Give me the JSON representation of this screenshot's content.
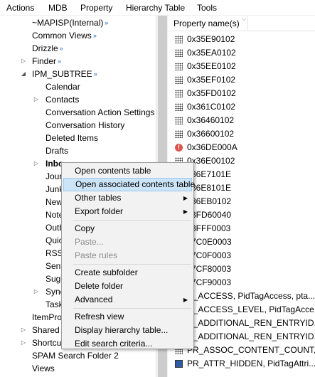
{
  "menubar": {
    "items": [
      "Actions",
      "MDB",
      "Property",
      "Hierarchy Table",
      "Tools"
    ]
  },
  "tree": {
    "rows": [
      {
        "label": "~MAPISP(Internal)",
        "arrows": "»",
        "expander": ""
      },
      {
        "label": "Common Views",
        "arrows": "»",
        "expander": ""
      },
      {
        "label": "Drizzle",
        "arrows": "»",
        "expander": ""
      },
      {
        "label": "Finder",
        "arrows": "»",
        "expander": "▷"
      },
      {
        "label": "IPM_SUBTREE",
        "arrows": "»",
        "expander": "◢"
      },
      {
        "label": "Calendar",
        "arrows": "",
        "expander": ""
      },
      {
        "label": "Contacts",
        "arrows": "",
        "expander": "▷"
      },
      {
        "label": "Conversation Action Settings",
        "arrows": "",
        "expander": ""
      },
      {
        "label": "Conversation History",
        "arrows": "",
        "expander": ""
      },
      {
        "label": "Deleted Items",
        "arrows": "",
        "expander": ""
      },
      {
        "label": "Drafts",
        "arrows": "",
        "expander": ""
      },
      {
        "label": "Inbo",
        "arrows": "",
        "expander": "▷"
      },
      {
        "label": "Jour",
        "arrows": "",
        "expander": ""
      },
      {
        "label": "Junk",
        "arrows": "",
        "expander": ""
      },
      {
        "label": "New",
        "arrows": "",
        "expander": ""
      },
      {
        "label": "Note",
        "arrows": "",
        "expander": ""
      },
      {
        "label": "Outb",
        "arrows": "",
        "expander": ""
      },
      {
        "label": "Quic",
        "arrows": "",
        "expander": ""
      },
      {
        "label": "RSS",
        "arrows": "",
        "expander": ""
      },
      {
        "label": "Sent",
        "arrows": "",
        "expander": ""
      },
      {
        "label": "Sugg",
        "arrows": "",
        "expander": ""
      },
      {
        "label": "Sync",
        "arrows": "",
        "expander": "▷"
      },
      {
        "label": "Task",
        "arrows": "",
        "expander": ""
      },
      {
        "label": "ItemPro",
        "arrows": "",
        "expander": ""
      },
      {
        "label": "Shared",
        "arrows": "",
        "expander": "▷"
      },
      {
        "label": "Shortcu",
        "arrows": "",
        "expander": "▷"
      },
      {
        "label": "SPAM Search Folder 2",
        "arrows": "",
        "expander": ""
      },
      {
        "label": "Views",
        "arrows": "",
        "expander": ""
      }
    ]
  },
  "properties": {
    "column_header": "Property name(s)",
    "rows": [
      {
        "name": "0x35E90102",
        "icon": "grid"
      },
      {
        "name": "0x35EA0102",
        "icon": "grid"
      },
      {
        "name": "0x35EE0102",
        "icon": "grid"
      },
      {
        "name": "0x35EF0102",
        "icon": "grid"
      },
      {
        "name": "0x35FD0102",
        "icon": "grid"
      },
      {
        "name": "0x361C0102",
        "icon": "grid"
      },
      {
        "name": "0x36460102",
        "icon": "grid"
      },
      {
        "name": "0x36600102",
        "icon": "grid"
      },
      {
        "name": "0x36DE000A",
        "icon": "error"
      },
      {
        "name": "0x36E00102",
        "icon": "grid"
      },
      {
        "name": "x36E7101E",
        "icon": "grid"
      },
      {
        "name": "x36E8101E",
        "icon": "grid"
      },
      {
        "name": "x36EB0102",
        "icon": "grid"
      },
      {
        "name": "x3FD60040",
        "icon": "grid"
      },
      {
        "name": "x3FFF0003",
        "icon": "grid"
      },
      {
        "name": "x7C0E0003",
        "icon": "grid"
      },
      {
        "name": "x7C0F0003",
        "icon": "grid"
      },
      {
        "name": "x7CF80003",
        "icon": "grid"
      },
      {
        "name": "x7CF90003",
        "icon": "grid"
      },
      {
        "name": "R_ACCESS, PidTagAccess, pta...",
        "icon": "grid"
      },
      {
        "name": "R_ACCESS_LEVEL, PidTagAcce...",
        "icon": "grid"
      },
      {
        "name": "R_ADDITIONAL_REN_ENTRYID...",
        "icon": "grid"
      },
      {
        "name": "R_ADDITIONAL_REN_ENTRYID...",
        "icon": "grid"
      },
      {
        "name": "PR_ASSOC_CONTENT_COUNT,...",
        "icon": "grid"
      },
      {
        "name": "PR_ATTR_HIDDEN, PidTagAttri...",
        "icon": "square"
      }
    ]
  },
  "context_menu": {
    "items": [
      {
        "label": "Open contents table",
        "type": "item"
      },
      {
        "label": "Open associated contents table",
        "type": "item",
        "highlighted": true
      },
      {
        "label": "Other tables",
        "type": "submenu"
      },
      {
        "label": "Export folder",
        "type": "submenu"
      },
      {
        "type": "separator"
      },
      {
        "label": "Copy",
        "type": "item"
      },
      {
        "label": "Paste...",
        "type": "disabled"
      },
      {
        "label": "Paste rules",
        "type": "disabled"
      },
      {
        "type": "separator"
      },
      {
        "label": "Create subfolder",
        "type": "item"
      },
      {
        "label": "Delete folder",
        "type": "item"
      },
      {
        "label": "Advanced",
        "type": "submenu"
      },
      {
        "type": "separator"
      },
      {
        "label": "Refresh view",
        "type": "item"
      },
      {
        "label": "Display hierarchy table...",
        "type": "item"
      },
      {
        "label": "Edit search criteria...",
        "type": "item"
      }
    ]
  },
  "colors": {
    "highlight_bg": "#cce4f7",
    "highlight_border": "#99c9ef",
    "arrow_blue": "#1a66c2",
    "disabled_text": "#8c8c8c"
  }
}
